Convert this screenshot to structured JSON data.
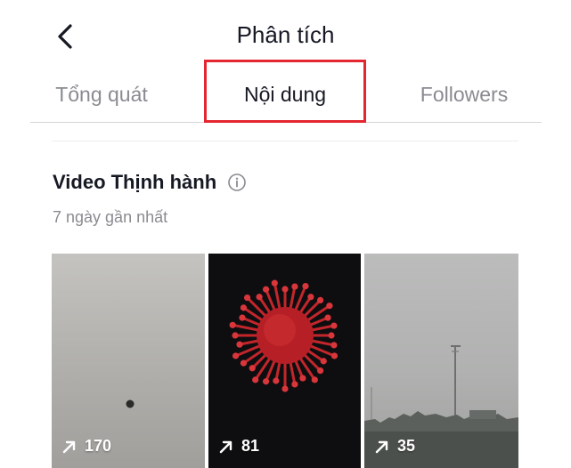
{
  "header": {
    "title": "Phân tích",
    "back_icon": "chevron-left-icon"
  },
  "tabs": [
    {
      "label": "Tổng quát",
      "active": false
    },
    {
      "label": "Nội dung",
      "active": true
    },
    {
      "label": "Followers",
      "active": false
    }
  ],
  "highlight_color": "#e3262f",
  "section": {
    "title": "Video Thịnh hành",
    "subtitle": "7 ngày gần nhất",
    "info_icon": "info-icon"
  },
  "videos": [
    {
      "views": "170"
    },
    {
      "views": "81"
    },
    {
      "views": "35"
    }
  ],
  "colors": {
    "text": "#161823",
    "muted": "#8a8b91",
    "accent_red": "#e3262f"
  }
}
